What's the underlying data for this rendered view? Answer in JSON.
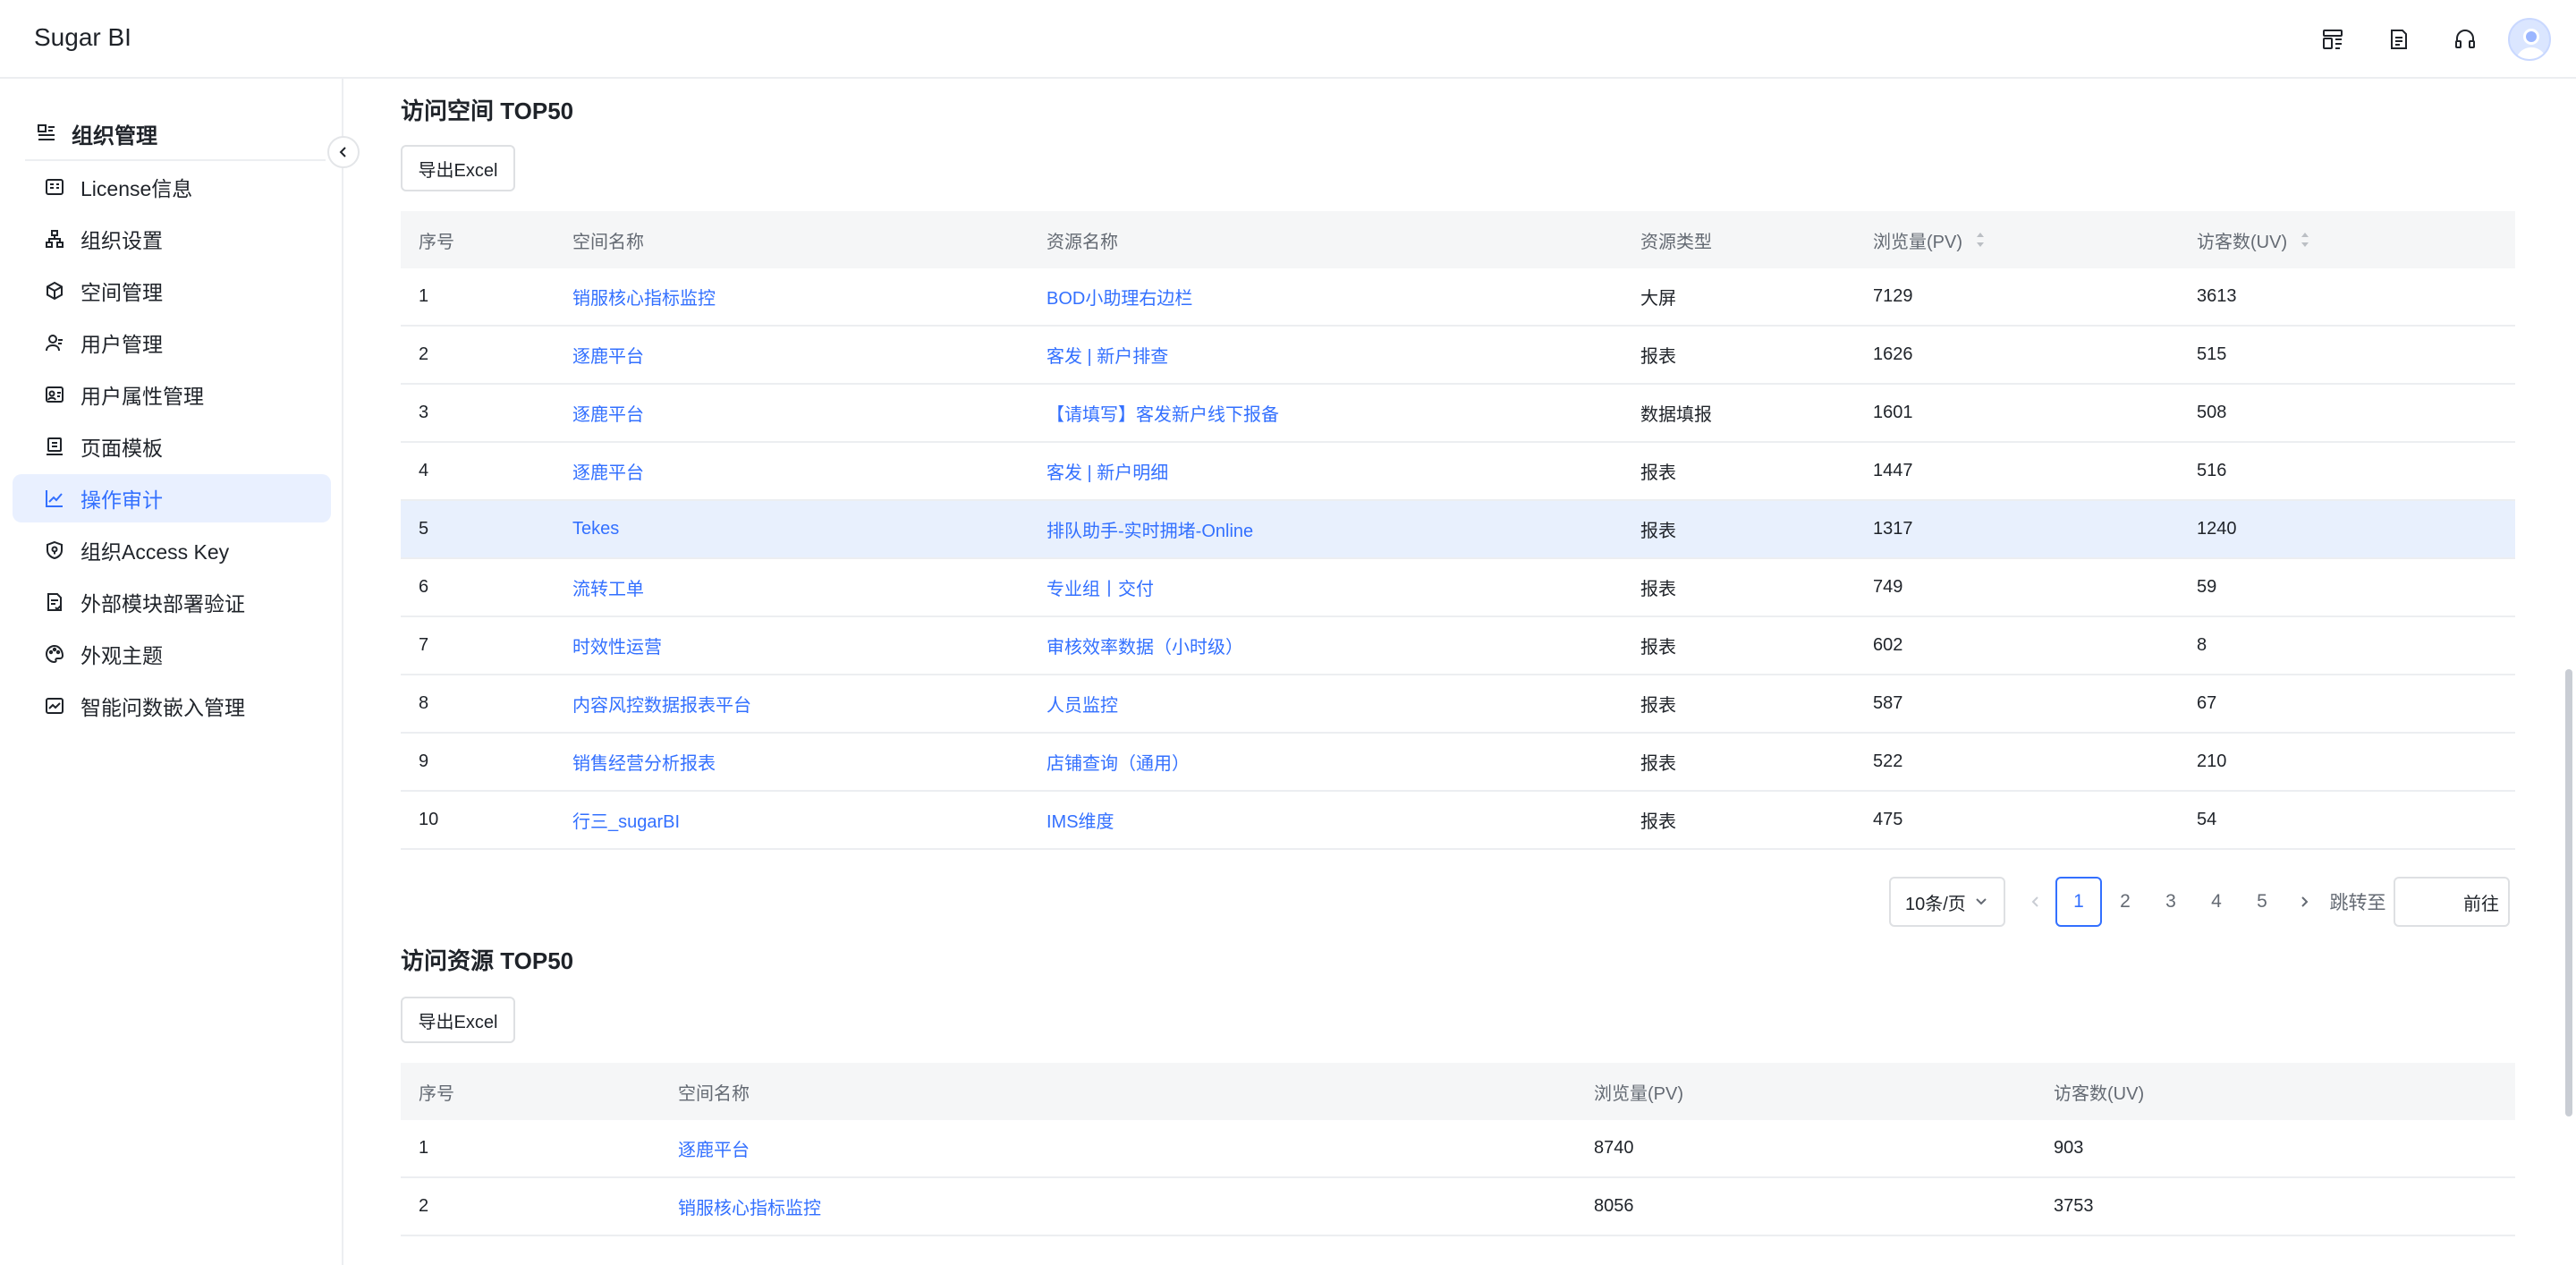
{
  "app": {
    "title": "Sugar BI"
  },
  "sidebar": {
    "section_title": "组织管理",
    "items": [
      {
        "label": "License信息",
        "icon": "license-icon"
      },
      {
        "label": "组织设置",
        "icon": "org-tree-icon"
      },
      {
        "label": "空间管理",
        "icon": "cube-icon"
      },
      {
        "label": "用户管理",
        "icon": "user-icon"
      },
      {
        "label": "用户属性管理",
        "icon": "user-card-icon"
      },
      {
        "label": "页面模板",
        "icon": "template-icon"
      },
      {
        "label": "操作审计",
        "icon": "trend-icon",
        "active": true
      },
      {
        "label": "组织Access Key",
        "icon": "shield-icon"
      },
      {
        "label": "外部模块部署验证",
        "icon": "doc-check-icon"
      },
      {
        "label": "外观主题",
        "icon": "palette-icon"
      },
      {
        "label": "智能问数嵌入管理",
        "icon": "embed-icon"
      }
    ]
  },
  "space_top": {
    "title": "访问空间 TOP50",
    "export_label": "导出Excel",
    "headers": [
      "序号",
      "空间名称",
      "资源名称",
      "资源类型",
      "浏览量(PV)",
      "访客数(UV)"
    ],
    "rows": [
      [
        "1",
        "销服核心指标监控",
        "BOD小助理右边栏",
        "大屏",
        "7129",
        "3613"
      ],
      [
        "2",
        "逐鹿平台",
        "客发 | 新户排查",
        "报表",
        "1626",
        "515"
      ],
      [
        "3",
        "逐鹿平台",
        "【请填写】客发新户线下报备",
        "数据填报",
        "1601",
        "508"
      ],
      [
        "4",
        "逐鹿平台",
        "客发 | 新户明细",
        "报表",
        "1447",
        "516"
      ],
      [
        "5",
        "Tekes",
        "排队助手-实时拥堵-Online",
        "报表",
        "1317",
        "1240"
      ],
      [
        "6",
        "流转工单",
        "专业组丨交付",
        "报表",
        "749",
        "59"
      ],
      [
        "7",
        "时效性运营",
        "审核效率数据（小时级）",
        "报表",
        "602",
        "8"
      ],
      [
        "8",
        "内容风控数据报表平台",
        "人员监控",
        "报表",
        "587",
        "67"
      ],
      [
        "9",
        "销售经营分析报表",
        "店铺查询（通用）",
        "报表",
        "522",
        "210"
      ],
      [
        "10",
        "行三_sugarBI",
        "IMS维度",
        "报表",
        "475",
        "54"
      ]
    ],
    "highlight_row": 4
  },
  "pagination": {
    "page_size": "10条/页",
    "pages": [
      "1",
      "2",
      "3",
      "4",
      "5"
    ],
    "current": "1",
    "jump_label": "跳转至",
    "go_label": "前往"
  },
  "resource_top": {
    "title": "访问资源 TOP50",
    "export_label": "导出Excel",
    "headers": [
      "序号",
      "空间名称",
      "浏览量(PV)",
      "访客数(UV)"
    ],
    "rows": [
      [
        "1",
        "逐鹿平台",
        "8740",
        "903"
      ],
      [
        "2",
        "销服核心指标监控",
        "8056",
        "3753"
      ]
    ]
  },
  "colors": {
    "accent": "#3370ff",
    "active_bg": "#e9f0ff",
    "highlight_row": "#e8f0fd",
    "header_bg": "#f5f6f7"
  }
}
